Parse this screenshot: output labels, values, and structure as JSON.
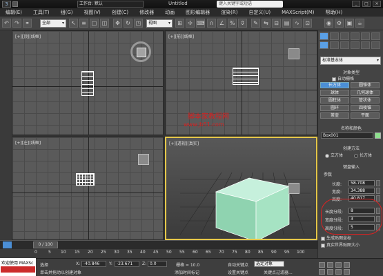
{
  "app": {
    "workspace": "工作台: 默认",
    "title": "Untitled",
    "search_placeholder": "键入关键字或短语"
  },
  "menu": [
    "编辑(E)",
    "工具(T)",
    "组(G)",
    "视图(V)",
    "创建(C)",
    "修改器",
    "动画",
    "图形编辑器",
    "渲染(R)",
    "自定义(U)",
    "MAXScript(M)",
    "帮助(H)"
  ],
  "toolbar": {
    "filter": "全部",
    "view": "视图"
  },
  "viewports": {
    "top": "[+][顶][线框]",
    "front": "[+][前][线框]",
    "left": "[+][左][线框]",
    "persp": "[+][透视][真实]"
  },
  "watermark": {
    "line1": "脚本家教程网",
    "line2": "www.jb51.com"
  },
  "timeline": {
    "frame": "0 / 100",
    "ticks": [
      "0",
      "5",
      "10",
      "15",
      "20",
      "25",
      "30",
      "35",
      "40",
      "45",
      "50",
      "55",
      "60",
      "65",
      "70",
      "75",
      "80",
      "85",
      "90",
      "95",
      "100"
    ]
  },
  "status": {
    "maxscript": "欢迎使用 MAXSc",
    "selected": "选择",
    "x": "-40.846",
    "y": "-23.671",
    "z": "0.0",
    "grid": "栅格 = 10.0",
    "auto_key": "自动关键点",
    "set_key": "设置关键点",
    "selected_obj": "选定对象",
    "prompt": "单击并拖动以创建对象",
    "add_time_tag": "添加时间标记",
    "key_filter": "关键点过滤器..."
  },
  "panel": {
    "dropdown": "标准基本体",
    "object_type": "对象类型",
    "autogrid": "自动栅格",
    "objects": [
      "长方体",
      "圆锥体",
      "球体",
      "几何球体",
      "圆柱体",
      "管状体",
      "圆环",
      "四棱锥",
      "茶壶",
      "平面"
    ],
    "name_color": "名称和颜色",
    "name": "Box001",
    "creation_method": "创建方法",
    "cube": "立方体",
    "box": "长方体",
    "keyboard": "键盘输入",
    "params": "参数",
    "length_label": "长度:",
    "length": "58.708",
    "width_label": "宽度:",
    "width": "34.388",
    "height_label": "高度:",
    "height": "40.817",
    "lseg_label": "长度分段:",
    "lseg": "8",
    "wseg_label": "宽度分段:",
    "wseg": "3",
    "hseg_label": "高度分段:",
    "hseg": "5",
    "gen_uv": "生成贴图坐标",
    "real_world": "真实世界贴图大小"
  },
  "colors": {
    "selected": "#4b8fd6",
    "box": "#a6e3c3",
    "highlight": "#d22222"
  }
}
